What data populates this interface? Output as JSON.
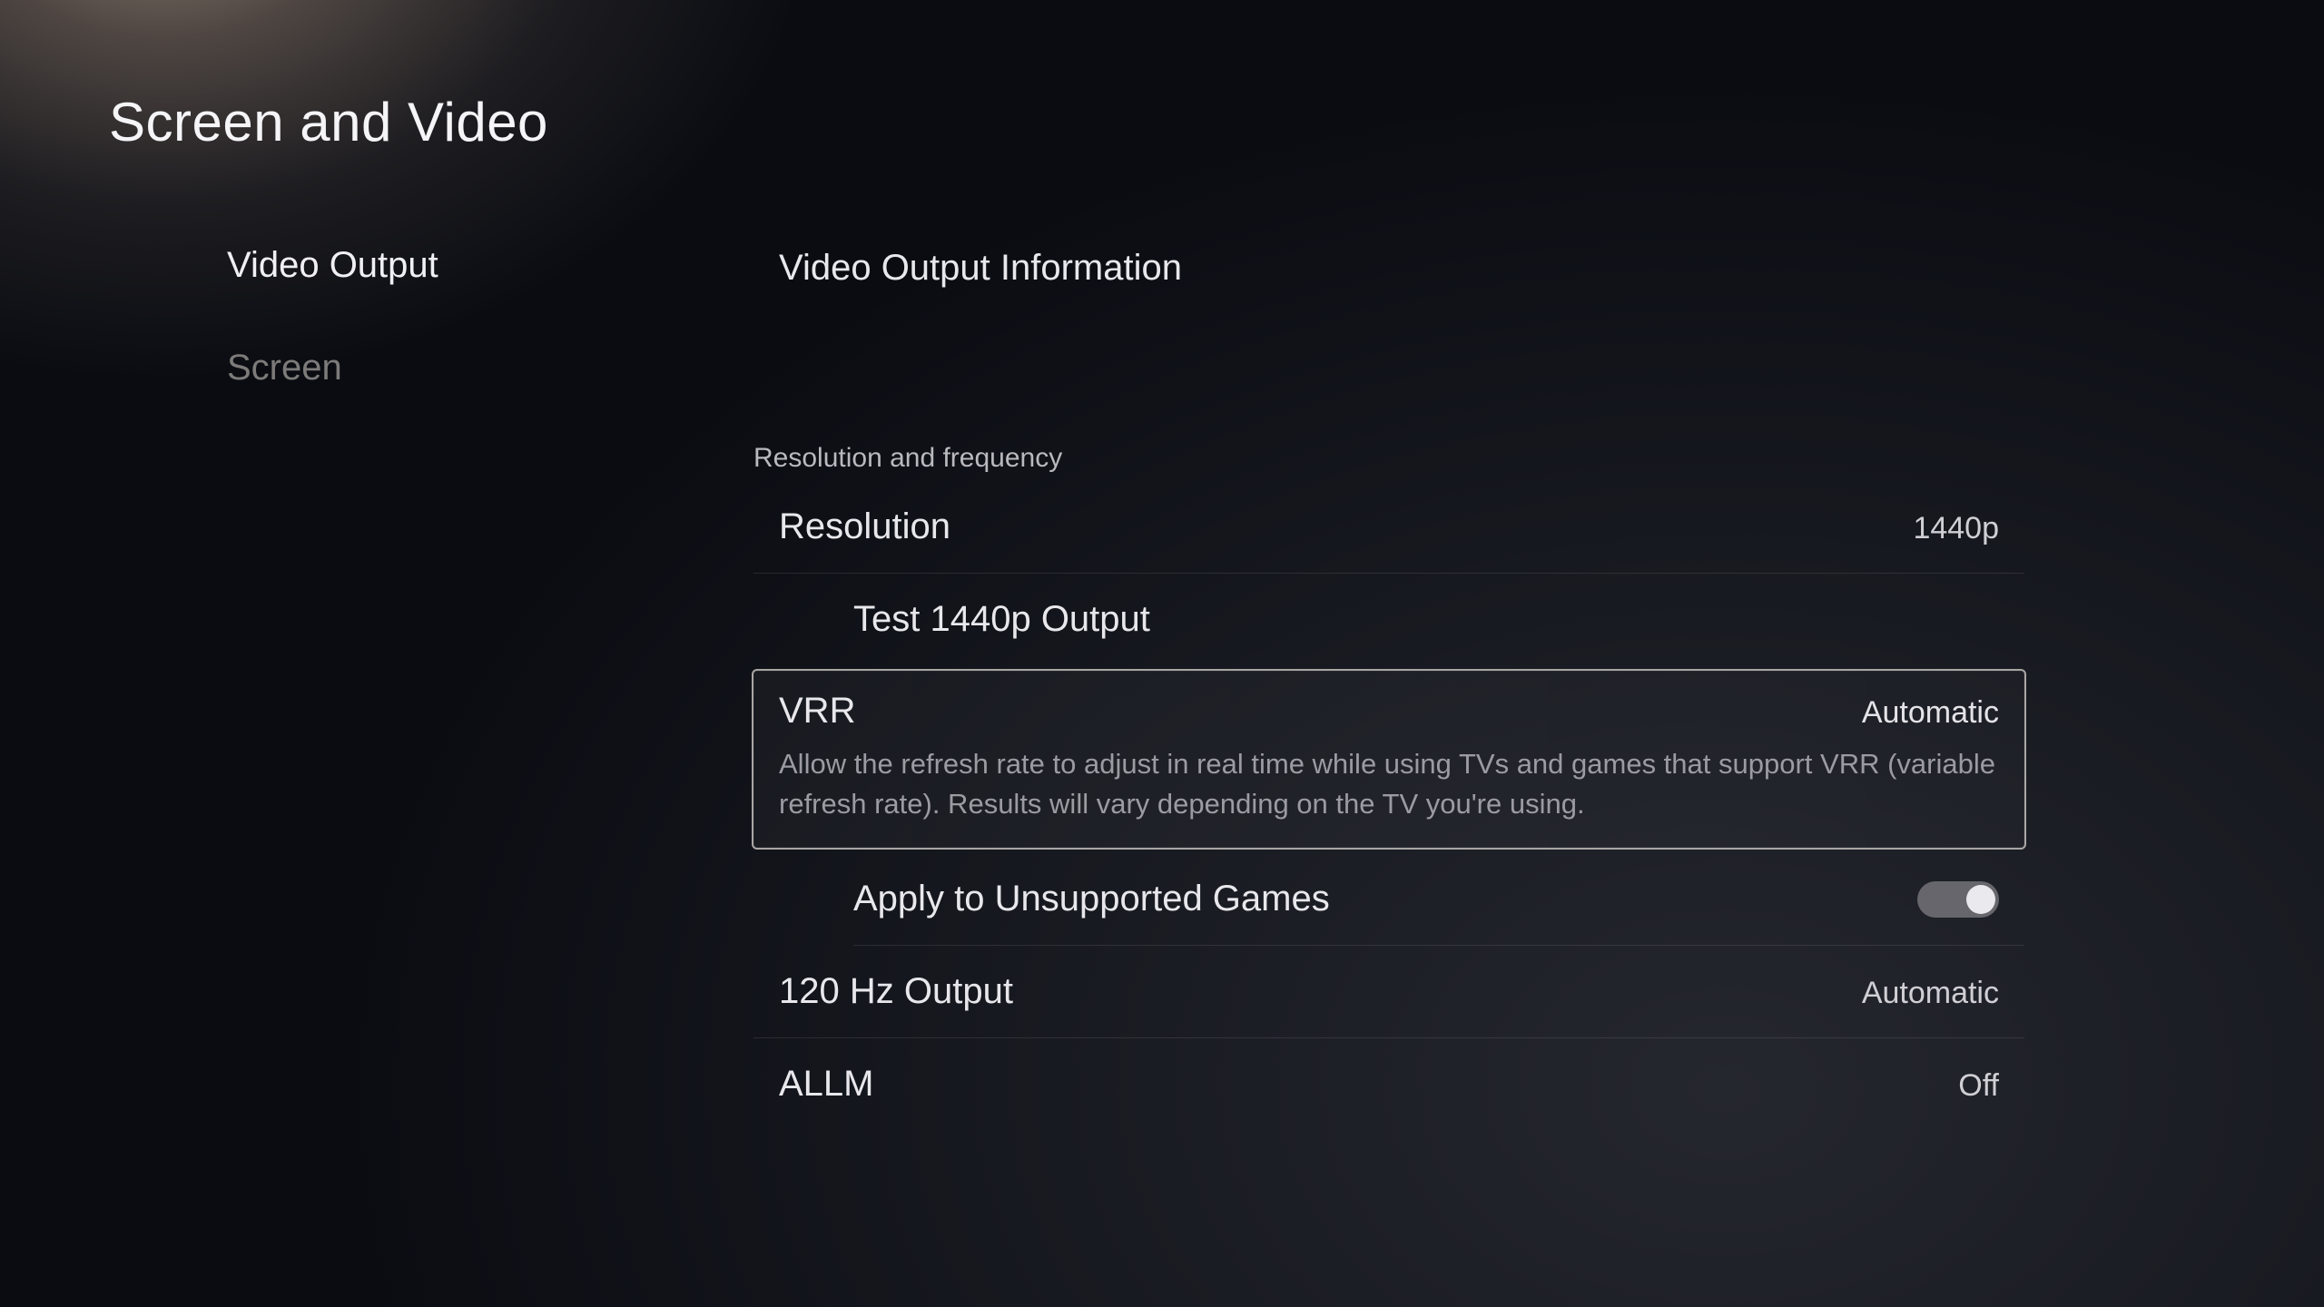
{
  "page_title": "Screen and Video",
  "sidebar": {
    "items": [
      {
        "label": "Video Output",
        "active": true
      },
      {
        "label": "Screen",
        "active": false
      }
    ]
  },
  "content": {
    "info_link_label": "Video Output Information",
    "section_header": "Resolution and frequency",
    "resolution": {
      "label": "Resolution",
      "value": "1440p"
    },
    "test_output": {
      "label": "Test 1440p Output"
    },
    "vrr": {
      "label": "VRR",
      "value": "Automatic",
      "description": "Allow the refresh rate to adjust in real time while using TVs and games that support VRR (variable refresh rate). Results will vary depending on the TV you're using."
    },
    "apply_unsupported": {
      "label": "Apply to Unsupported Games",
      "toggle_on": true
    },
    "hz120": {
      "label": "120 Hz Output",
      "value": "Automatic"
    },
    "allm": {
      "label": "ALLM",
      "value": "Off"
    }
  }
}
